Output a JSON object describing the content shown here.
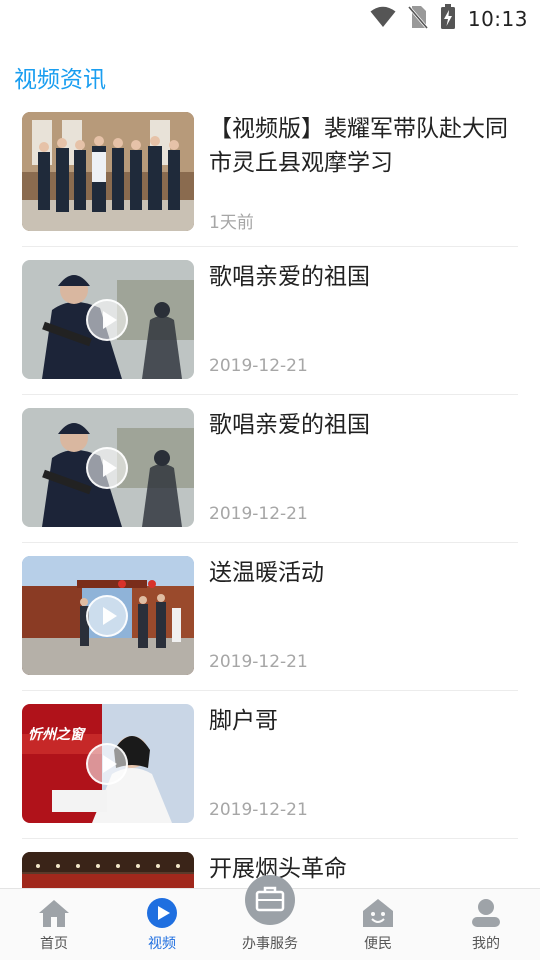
{
  "status_bar": {
    "time": "10:13",
    "icons": [
      "wifi-icon",
      "no-sim-icon",
      "battery-charging-icon"
    ]
  },
  "page": {
    "title": "视频资讯"
  },
  "feed": [
    {
      "title": "【视频版】裴耀军带队赴大同市灵丘县观摩学习",
      "date": "1天前",
      "has_play": false
    },
    {
      "title": "歌唱亲爱的祖国",
      "date": "2019-12-21",
      "has_play": true
    },
    {
      "title": "歌唱亲爱的祖国",
      "date": "2019-12-21",
      "has_play": true
    },
    {
      "title": "送温暖活动",
      "date": "2019-12-21",
      "has_play": true
    },
    {
      "title": "脚户哥",
      "date": "2019-12-21",
      "has_play": true
    },
    {
      "title": "开展烟头革命",
      "date": "",
      "has_play": false
    }
  ],
  "thumb_text": {
    "show_logo": "忻州之窗"
  },
  "tab_bar": {
    "items": [
      {
        "label": "首页",
        "icon": "home-icon"
      },
      {
        "label": "视频",
        "icon": "play-circle-icon"
      },
      {
        "label": "办事服务",
        "icon": "briefcase-icon"
      },
      {
        "label": "便民",
        "icon": "smiley-house-icon"
      },
      {
        "label": "我的",
        "icon": "person-icon"
      }
    ],
    "active_index": 1
  },
  "colors": {
    "accent": "#1a9ef0",
    "tab_active": "#1f6fe0",
    "tab_inactive": "#9ea3a8",
    "date_gray": "#a6a6a6"
  }
}
